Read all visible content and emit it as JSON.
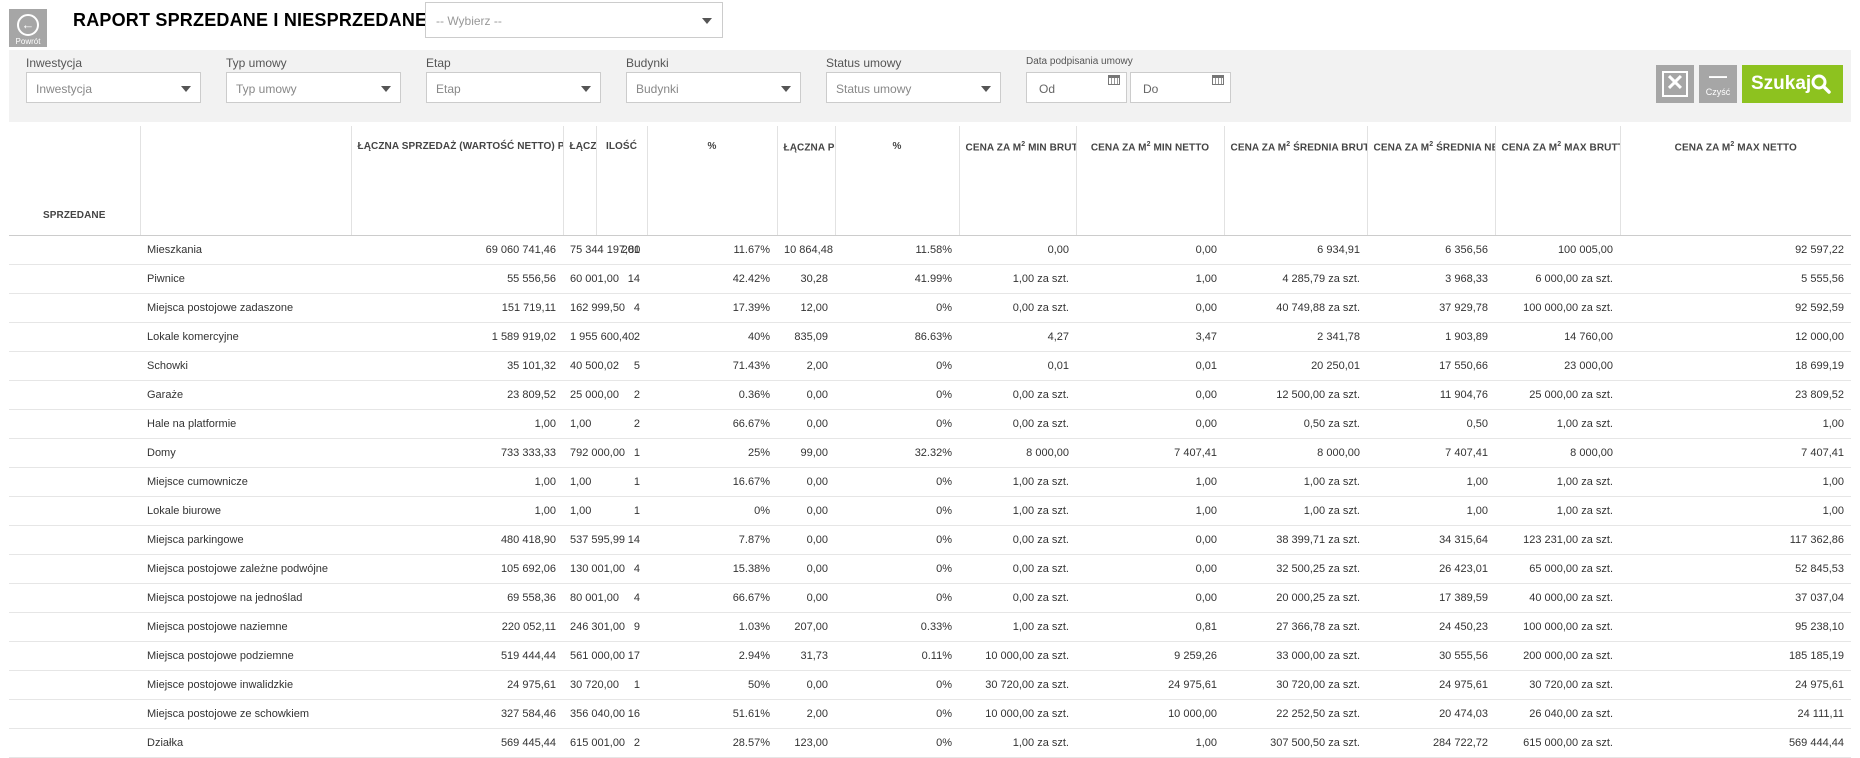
{
  "header": {
    "back_label": "Powrót",
    "title": "RAPORT SPRZEDANE I NIESPRZEDANE",
    "report_select": "-- Wybierz --"
  },
  "filters": {
    "inwestycja": {
      "label": "Inwestycja",
      "placeholder": "Inwestycja"
    },
    "typ_umowy": {
      "label": "Typ umowy",
      "placeholder": "Typ umowy"
    },
    "etap": {
      "label": "Etap",
      "placeholder": "Etap"
    },
    "budynki": {
      "label": "Budynki",
      "placeholder": "Budynki"
    },
    "status_umowy": {
      "label": "Status umowy",
      "placeholder": "Status umowy"
    },
    "data_podpisania": {
      "label": "Data podpisania umowy",
      "from_placeholder": "Od",
      "to_placeholder": "Do"
    },
    "clear_label": "Czyść",
    "search_label": "Szukaj"
  },
  "table": {
    "section_label": "SPRZEDANE",
    "columns": {
      "netto": "ŁĄCZNA SPRZEDAŻ (WARTOŚĆ NETTO) PLN",
      "brutto": "ŁĄCZNA SPRZEDAŻ (WARTOŚĆ BRUTTO) PLN",
      "ilosc": "ILOŚĆ",
      "pct1": "%",
      "powierzchnia": "ŁĄCZNA POWIERZCHNIA M",
      "pct2": "%",
      "min_brutto_a": "CENA ZA M",
      "min_brutto_b": " MIN BRUTTO",
      "min_netto_a": "CENA ZA M",
      "min_netto_b": " MIN NETTO",
      "sr_brutto_a": "CENA ZA M",
      "sr_brutto_b": " ŚREDNIA BRUTTO",
      "sr_netto_a": "CENA ZA M",
      "sr_netto_b": " ŚREDNIA NETTO",
      "max_brutto_a": "CENA ZA M",
      "max_brutto_b": " MAX BRUTTO",
      "max_netto_a": "CENA ZA M",
      "max_netto_b": " MAX NETTO",
      "sup": "2"
    },
    "rows": [
      [
        "Mieszkania",
        "69 060 741,46",
        "75 344 197,80",
        "201",
        "11.67%",
        "10 864,48",
        "11.58%",
        "0,00",
        "0,00",
        "6 934,91",
        "6 356,56",
        "100 005,00",
        "92 597,22"
      ],
      [
        "Piwnice",
        "55 556,56",
        "60 001,00",
        "14",
        "42.42%",
        "30,28",
        "41.99%",
        "1,00 za szt.",
        "1,00",
        "4 285,79 za szt.",
        "3 968,33",
        "6 000,00 za szt.",
        "5 555,56"
      ],
      [
        "Miejsca postojowe zadaszone",
        "151 719,11",
        "162 999,50",
        "4",
        "17.39%",
        "12,00",
        "0%",
        "0,00 za szt.",
        "0,00",
        "40 749,88 za szt.",
        "37 929,78",
        "100 000,00 za szt.",
        "92 592,59"
      ],
      [
        "Lokale komercyjne",
        "1 589 919,02",
        "1 955 600,40",
        "2",
        "40%",
        "835,09",
        "86.63%",
        "4,27",
        "3,47",
        "2 341,78",
        "1 903,89",
        "14 760,00",
        "12 000,00"
      ],
      [
        "Schowki",
        "35 101,32",
        "40 500,02",
        "5",
        "71.43%",
        "2,00",
        "0%",
        "0,01",
        "0,01",
        "20 250,01",
        "17 550,66",
        "23 000,00",
        "18 699,19"
      ],
      [
        "Garaże",
        "23 809,52",
        "25 000,00",
        "2",
        "0.36%",
        "0,00",
        "0%",
        "0,00 za szt.",
        "0,00",
        "12 500,00 za szt.",
        "11 904,76",
        "25 000,00 za szt.",
        "23 809,52"
      ],
      [
        "Hale na platformie",
        "1,00",
        "1,00",
        "2",
        "66.67%",
        "0,00",
        "0%",
        "0,00 za szt.",
        "0,00",
        "0,50 za szt.",
        "0,50",
        "1,00 za szt.",
        "1,00"
      ],
      [
        "Domy",
        "733 333,33",
        "792 000,00",
        "1",
        "25%",
        "99,00",
        "32.32%",
        "8 000,00",
        "7 407,41",
        "8 000,00",
        "7 407,41",
        "8 000,00",
        "7 407,41"
      ],
      [
        "Miejsce cumownicze",
        "1,00",
        "1,00",
        "1",
        "16.67%",
        "0,00",
        "0%",
        "1,00 za szt.",
        "1,00",
        "1,00 za szt.",
        "1,00",
        "1,00 za szt.",
        "1,00"
      ],
      [
        "Lokale biurowe",
        "1,00",
        "1,00",
        "1",
        "0%",
        "0,00",
        "0%",
        "1,00 za szt.",
        "1,00",
        "1,00 za szt.",
        "1,00",
        "1,00 za szt.",
        "1,00"
      ],
      [
        "Miejsca parkingowe",
        "480 418,90",
        "537 595,99",
        "14",
        "7.87%",
        "0,00",
        "0%",
        "0,00 za szt.",
        "0,00",
        "38 399,71 za szt.",
        "34 315,64",
        "123 231,00 za szt.",
        "117 362,86"
      ],
      [
        "Miejsca postojowe zależne podwójne",
        "105 692,06",
        "130 001,00",
        "4",
        "15.38%",
        "0,00",
        "0%",
        "0,00 za szt.",
        "0,00",
        "32 500,25 za szt.",
        "26 423,01",
        "65 000,00 za szt.",
        "52 845,53"
      ],
      [
        "Miejsca postojowe na jednoślad",
        "69 558,36",
        "80 001,00",
        "4",
        "66.67%",
        "0,00",
        "0%",
        "0,00 za szt.",
        "0,00",
        "20 000,25 za szt.",
        "17 389,59",
        "40 000,00 za szt.",
        "37 037,04"
      ],
      [
        "Miejsca postojowe naziemne",
        "220 052,11",
        "246 301,00",
        "9",
        "1.03%",
        "207,00",
        "0.33%",
        "1,00 za szt.",
        "0,81",
        "27 366,78 za szt.",
        "24 450,23",
        "100 000,00 za szt.",
        "95 238,10"
      ],
      [
        "Miejsca postojowe podziemne",
        "519 444,44",
        "561 000,00",
        "17",
        "2.94%",
        "31,73",
        "0.11%",
        "10 000,00 za szt.",
        "9 259,26",
        "33 000,00 za szt.",
        "30 555,56",
        "200 000,00 za szt.",
        "185 185,19"
      ],
      [
        "Miejsce postojowe inwalidzkie",
        "24 975,61",
        "30 720,00",
        "1",
        "50%",
        "0,00",
        "0%",
        "30 720,00 za szt.",
        "24 975,61",
        "30 720,00 za szt.",
        "24 975,61",
        "30 720,00 za szt.",
        "24 975,61"
      ],
      [
        "Miejsca postojowe ze schowkiem",
        "327 584,46",
        "356 040,00",
        "16",
        "51.61%",
        "2,00",
        "0%",
        "10 000,00 za szt.",
        "10 000,00",
        "22 252,50 za szt.",
        "20 474,03",
        "26 040,00 za szt.",
        "24 111,11"
      ],
      [
        "Działka",
        "569 445,44",
        "615 001,00",
        "2",
        "28.57%",
        "123,00",
        "0%",
        "1,00 za szt.",
        "1,00",
        "307 500,50 za szt.",
        "284 722,72",
        "615 000,00 za szt.",
        "569 444,44"
      ]
    ]
  }
}
